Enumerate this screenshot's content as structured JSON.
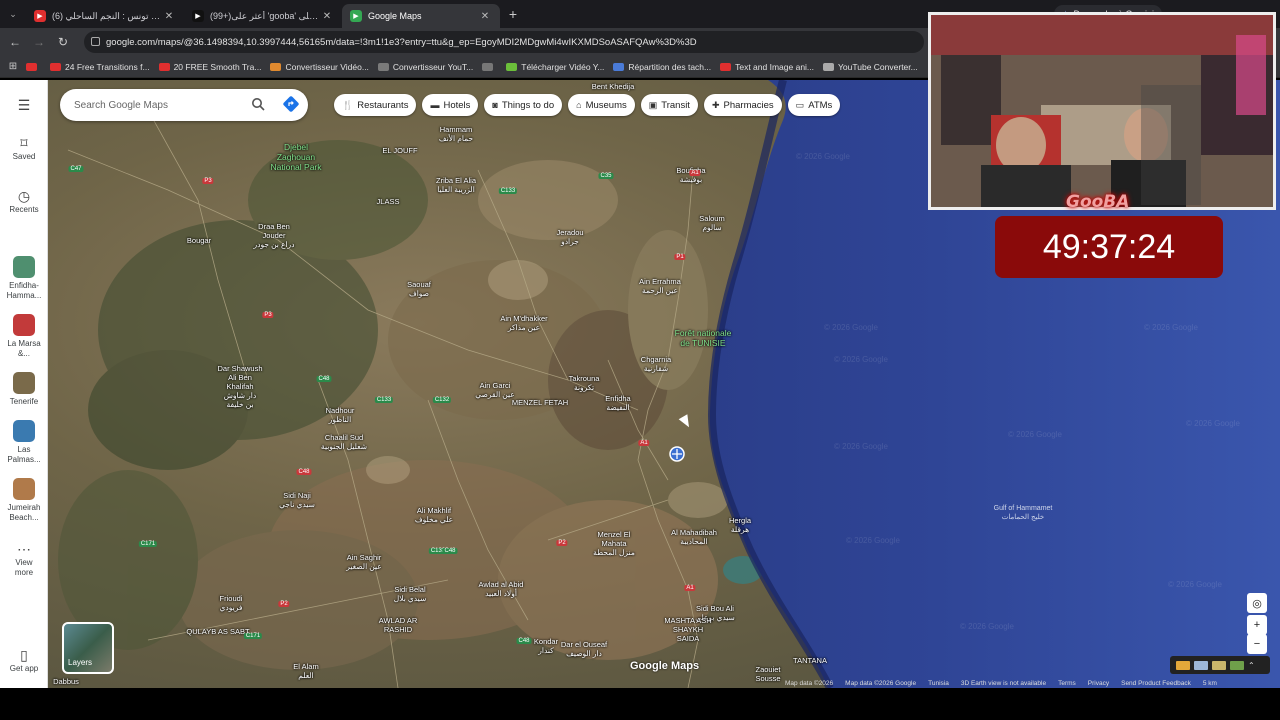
{
  "tabs": [
    {
      "title": "(6) كلاسيكو تونس : النجم الساحلي",
      "favicon": "youtube-icon",
      "color": "#e02f2f"
    },
    {
      "title": "(99+)أعثر على 'gooba' على TikTok",
      "favicon": "tiktok-icon",
      "color": "#111111"
    },
    {
      "title": "Google Maps",
      "favicon": "maps-icon",
      "color": "#34a853"
    }
  ],
  "gemini_label": "Demander à Gemini",
  "url": "google.com/maps/@36.1498394,10.3997444,56165m/data=!3m1!1e3?entry=ttu&g_ep=EgoyMDI2MDgwMi4wIKXMDSoASAFQAw%3D%3D",
  "bookmarks": [
    {
      "label": "",
      "color": "#e02f2f"
    },
    {
      "label": "24 Free Transitions f...",
      "color": "#e02f2f"
    },
    {
      "label": "20 FREE Smooth Tra...",
      "color": "#e02f2f"
    },
    {
      "label": "Convertisseur Vidéo...",
      "color": "#e08a2f"
    },
    {
      "label": "Convertisseur YouT...",
      "color": "#7a7a7a"
    },
    {
      "label": "",
      "color": "#777777"
    },
    {
      "label": "Télécharger Vidéo Y...",
      "color": "#6bbf3a"
    },
    {
      "label": "Répartition des tach...",
      "color": "#4a7bd8"
    },
    {
      "label": "Text and Image ani...",
      "color": "#e02f2f"
    },
    {
      "label": "YouTube Converter...",
      "color": "#aaaaaa"
    }
  ],
  "rail": {
    "saved": "Saved",
    "recents": "Recents",
    "recent_places": [
      {
        "label": "Enfidha-\nHamma...",
        "color": "#4f8f6f"
      },
      {
        "label": "La Marsa\n&...",
        "color": "#c23a3a"
      },
      {
        "label": "Tenerife",
        "color": "#7a6a4a"
      },
      {
        "label": "Las\nPalmas...",
        "color": "#3a7ab0"
      },
      {
        "label": "Jumeirah\nBeach...",
        "color": "#b07a4a"
      }
    ],
    "view_more": "View\nmore",
    "get_app": "Get app"
  },
  "search": {
    "placeholder": "Search Google Maps"
  },
  "chips": [
    {
      "label": "Restaurants",
      "icon": "fork-knife-icon"
    },
    {
      "label": "Hotels",
      "icon": "bed-icon"
    },
    {
      "label": "Things to do",
      "icon": "camera-icon"
    },
    {
      "label": "Museums",
      "icon": "museum-icon"
    },
    {
      "label": "Transit",
      "icon": "train-icon"
    },
    {
      "label": "Pharmacies",
      "icon": "pharmacy-icon"
    },
    {
      "label": "ATMs",
      "icon": "atm-icon"
    }
  ],
  "places": [
    {
      "label": "Hammam\nحمام الأنف"
    },
    {
      "label": "Djebel\nZaghouan\nNational Park",
      "kind": "green"
    },
    {
      "label": "EL JOUFF"
    },
    {
      "label": "Zriba El Alia\nالزريبة العليا"
    },
    {
      "label": "Bent Khedija"
    },
    {
      "label": "Bouficha\nبوفيشة"
    },
    {
      "label": "Saloum\nسالوم"
    },
    {
      "label": "Jeradou\nجرادو"
    },
    {
      "label": "JLASS"
    },
    {
      "label": "Draa Ben\nJouder\nدراع بن جودر"
    },
    {
      "label": "Bougar"
    },
    {
      "label": "Saouaf\nصواف"
    },
    {
      "label": "Ain Errahma\nعين الرحمة"
    },
    {
      "label": "Ain M'dhakker\nعين مذاكر"
    },
    {
      "label": "Forêt nationale\nde TUNISIE",
      "kind": "green"
    },
    {
      "label": "Chgarnia\nشقارنية"
    },
    {
      "label": "Dar Shawush\nAli Ben\nKhalifah\nدار شاوش\nبن خليفة"
    },
    {
      "label": "Ain Garci\nعين القرصي"
    },
    {
      "label": "Takrouna\nتكرونة"
    },
    {
      "label": "MENZEL FETAH"
    },
    {
      "label": "Enfidha\nالنفيضة"
    },
    {
      "label": "Nadhour\nالناظور"
    },
    {
      "label": "Chaalil Sud\nشعليل الجنوبية"
    },
    {
      "label": "Sidi Naji\nسيدي ناجي"
    },
    {
      "label": "Ali Makhlif\nعلي مخلوف"
    },
    {
      "label": "Menzel El\nMahata\nمنزل المحطة"
    },
    {
      "label": "Al Mahadibah\nالمحاديبة"
    },
    {
      "label": "Hergla\nهرقلة"
    },
    {
      "label": "Ain Saghir\nعين الصغير"
    },
    {
      "label": "Sidi Belal\nسيدي بلال"
    },
    {
      "label": "Awlad al Abid\nأولاد العبيد"
    },
    {
      "label": "AWLAD AR\nRASHID"
    },
    {
      "label": "Frioudi\nفريودي"
    },
    {
      "label": "QULAYB AS SABT"
    },
    {
      "label": "Kondar\nكندار"
    },
    {
      "label": "Dar el Ouseaf\nدار الوصيف"
    },
    {
      "label": "Sidi Bou Ali\nسيدي بوعلي"
    },
    {
      "label": "MASHTA ASH\nSHAYKH\nSAIDA"
    },
    {
      "label": "El Alam\nالعلم"
    },
    {
      "label": "Zaouiet\nSousse"
    },
    {
      "label": "TANTANA"
    },
    {
      "label": "Dabbus"
    }
  ],
  "roads": [
    "C47",
    "P3",
    "C133",
    "C35",
    "A1",
    "P1",
    "P3",
    "C48",
    "C133",
    "C132",
    "A1",
    "C48",
    "P2",
    "C171",
    "C133",
    "C171",
    "P2",
    "C48",
    "A1",
    "C48"
  ],
  "gulf": {
    "label": "Gulf of Hammamet\nخليج الحمامات"
  },
  "watermark": "© 2026 Google",
  "timer": "49:37:24",
  "brand": "GooBA",
  "layers_label": "Layers",
  "google_maps_logo": "Google Maps",
  "footer": [
    "Map data ©2026",
    "Map data ©2026 Google",
    "Tunisia",
    "3D Earth view is not available",
    "Terms",
    "Privacy",
    "Send Product Feedback",
    "5 km"
  ]
}
